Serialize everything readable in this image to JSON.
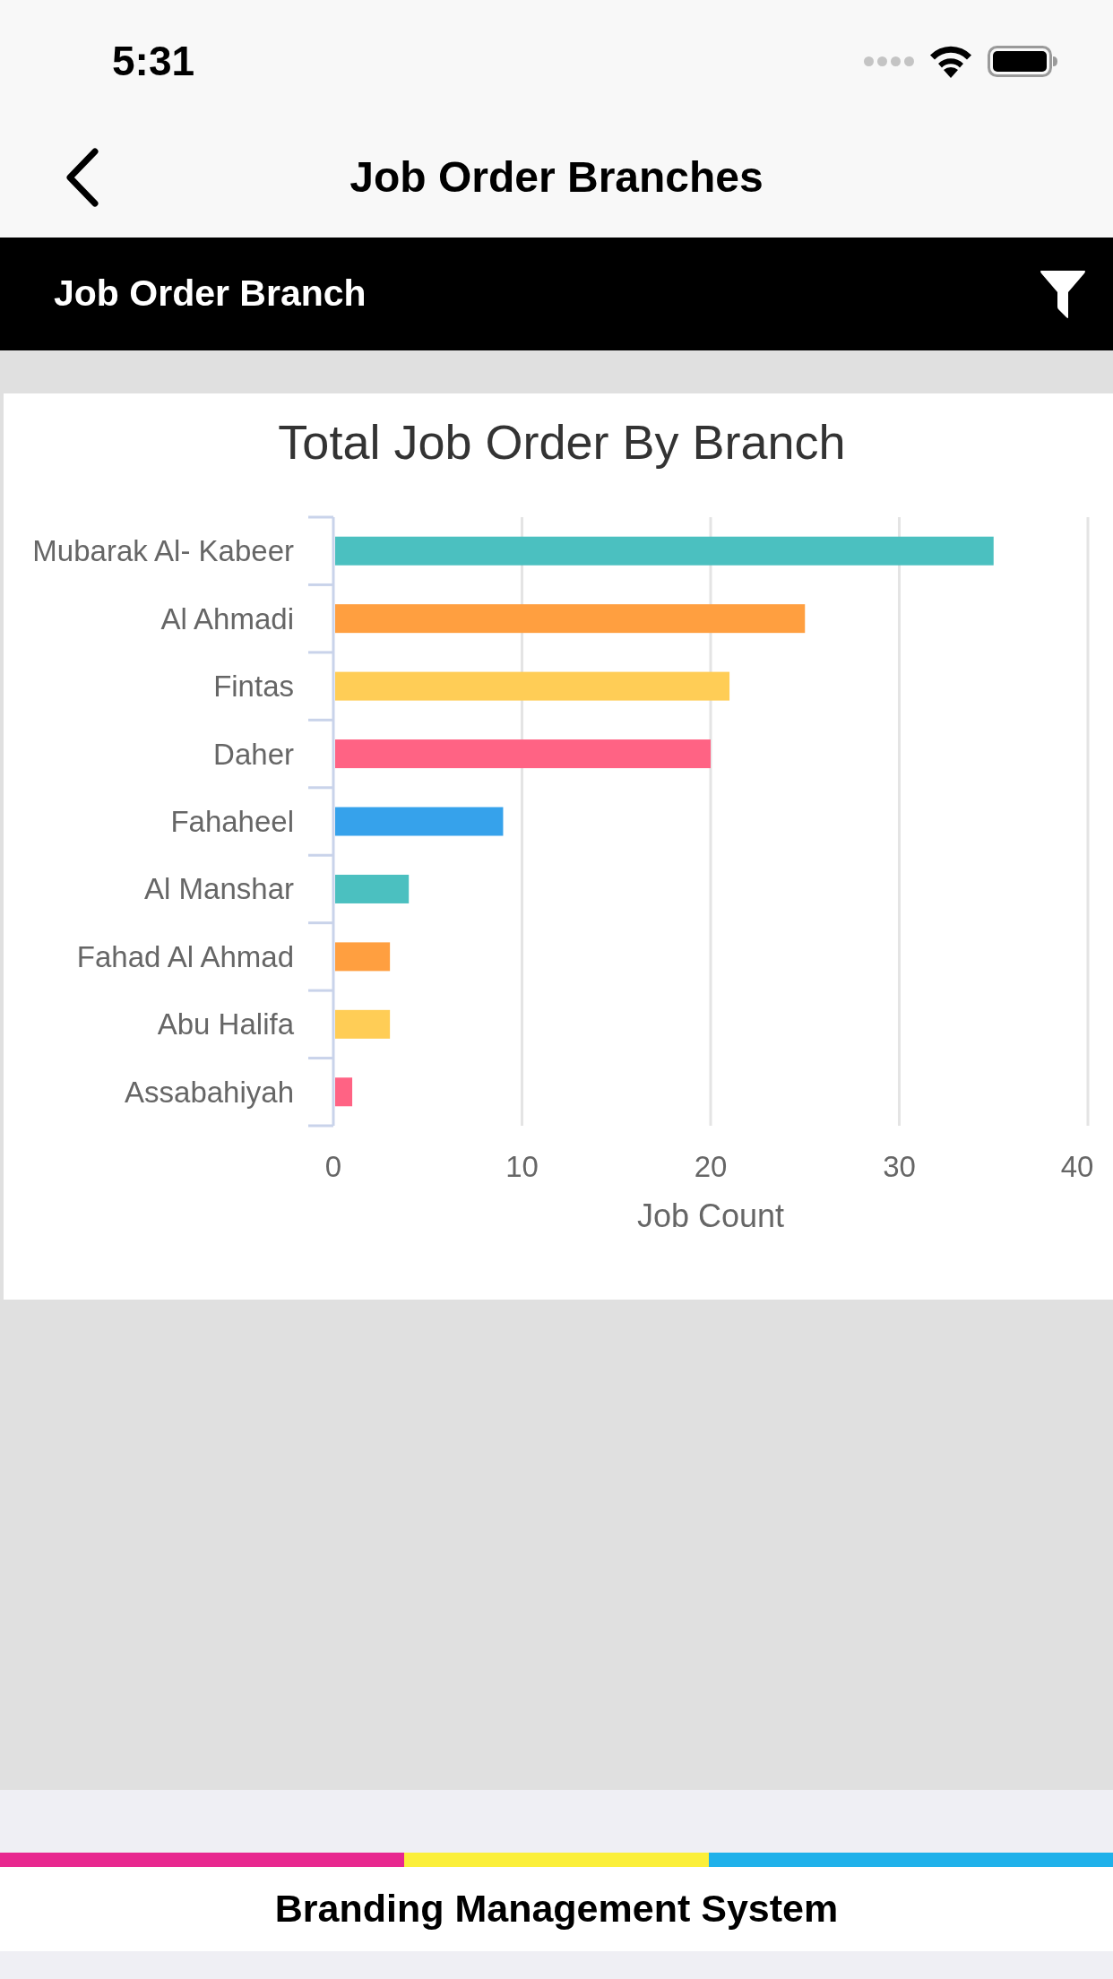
{
  "status_bar": {
    "time": "5:31"
  },
  "nav_bar": {
    "title": "Job Order Branches"
  },
  "section_header": {
    "title": "Job Order Branch"
  },
  "chart_card": {
    "chart_data": {
      "type": "bar",
      "orientation": "horizontal",
      "title": "Total Job Order By Branch",
      "xlabel": "Job Count",
      "categories": [
        "Mubarak Al- Kabeer",
        "Al Ahmadi",
        "Fintas",
        "Daher",
        "Fahaheel",
        "Al Manshar",
        "Fahad Al Ahmad",
        "Abu Halifa",
        "Assabahiyah"
      ],
      "values": [
        35,
        25,
        21,
        20,
        9,
        4,
        3,
        3,
        1
      ],
      "colors": [
        "#4bc0c0",
        "#ff9f40",
        "#ffcd56",
        "#ff6384",
        "#36a2eb",
        "#4bc0c0",
        "#ff9f40",
        "#ffcd56",
        "#ff6384"
      ],
      "xlim": [
        0,
        40
      ],
      "xticks": [
        0,
        10,
        20,
        30,
        40
      ],
      "grid": true
    }
  },
  "footer": {
    "stripes": [
      {
        "color": "#e8288f"
      },
      {
        "color": "#fbef3a"
      },
      {
        "color": "#1fb1ea"
      }
    ],
    "title": "Branding Management System"
  }
}
